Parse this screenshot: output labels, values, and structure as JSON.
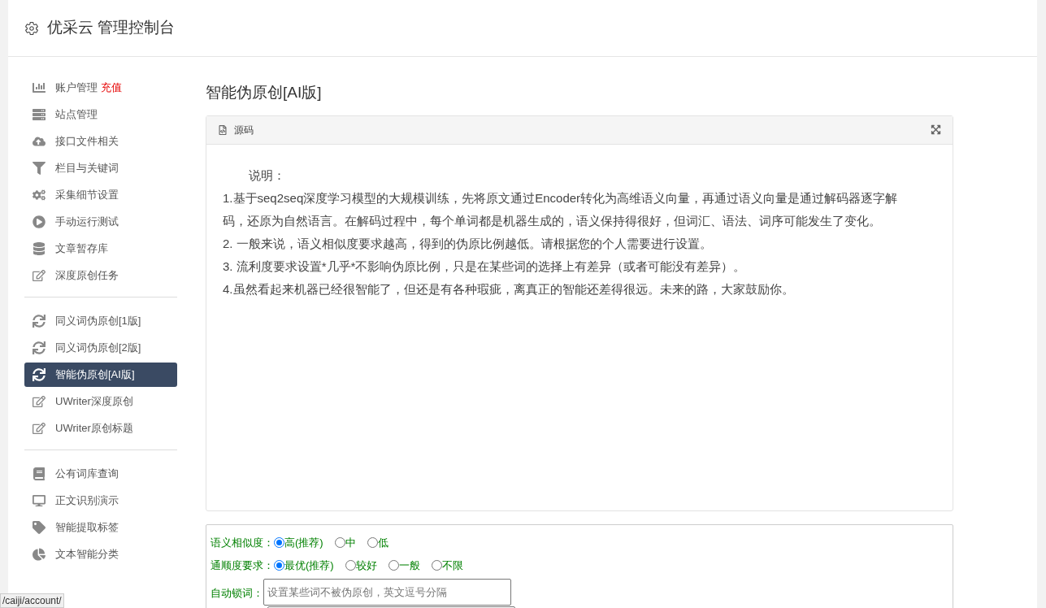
{
  "header": {
    "title": "优采云 管理控制台"
  },
  "sidebar": {
    "groups": [
      {
        "items": [
          {
            "label": "账户管理",
            "badge": "充值",
            "selected": false
          },
          {
            "label": "站点管理",
            "selected": false
          },
          {
            "label": "接口文件相关",
            "selected": false
          },
          {
            "label": "栏目与关键词",
            "selected": false
          },
          {
            "label": "采集细节设置",
            "selected": false
          },
          {
            "label": "手动运行测试",
            "selected": false
          },
          {
            "label": "文章暂存库",
            "selected": false
          },
          {
            "label": "深度原创任务",
            "selected": false
          }
        ]
      },
      {
        "items": [
          {
            "label": "同义词伪原创[1版]",
            "selected": false
          },
          {
            "label": "同义词伪原创[2版]",
            "selected": false
          },
          {
            "label": "智能伪原创[AI版]",
            "selected": true
          },
          {
            "label": "UWriter深度原创",
            "selected": false
          },
          {
            "label": "UWriter原创标题",
            "selected": false
          }
        ]
      },
      {
        "items": [
          {
            "label": "公有词库查询",
            "selected": false
          },
          {
            "label": "正文识别演示",
            "selected": false
          },
          {
            "label": "智能提取标签",
            "selected": false
          },
          {
            "label": "文本智能分类",
            "selected": false
          }
        ]
      }
    ]
  },
  "main": {
    "title": "智能伪原创[AI版]",
    "source_panel": {
      "tab": "源码",
      "lines": [
        "说明：",
        "1.基于seq2seq深度学习模型的大规模训练，先将原文通过Encoder转化为高维语义向量，再通过语义向量是通过解码器逐字解码，还原为自然语言。在解码过程中，每个单词都是机器生成的，语义保持得很好，但词汇、语法、词序可能发生了变化。",
        "2. 一般来说，语义相似度要求越高，得到的伪原比例越低。请根据您的个人需要进行设置。",
        "3. 流利度要求设置*几乎*不影响伪原比例，只是在某些词的选择上有差异（或者可能没有差异）。",
        "4.虽然看起来机器已经很智能了，但还是有各种瑕疵，离真正的智能还差得很远。未来的路，大家鼓励你。"
      ]
    },
    "options": [
      {
        "label": "语义相似度：",
        "choices": [
          {
            "label": "高(推荐)",
            "selected": true
          },
          {
            "label": "中",
            "selected": false
          },
          {
            "label": "低",
            "selected": false
          }
        ]
      },
      {
        "label": "通顺度要求：",
        "choices": [
          {
            "label": "最优(推荐)",
            "selected": true
          },
          {
            "label": "较好",
            "selected": false
          },
          {
            "label": "一般",
            "selected": false
          },
          {
            "label": "不限",
            "selected": false
          }
        ]
      }
    ],
    "lock_words": {
      "label": "自动锁词：",
      "placeholder": "设置某些词不被伪原创，英文逗号分隔"
    }
  },
  "status_url": "/caiji/account/"
}
